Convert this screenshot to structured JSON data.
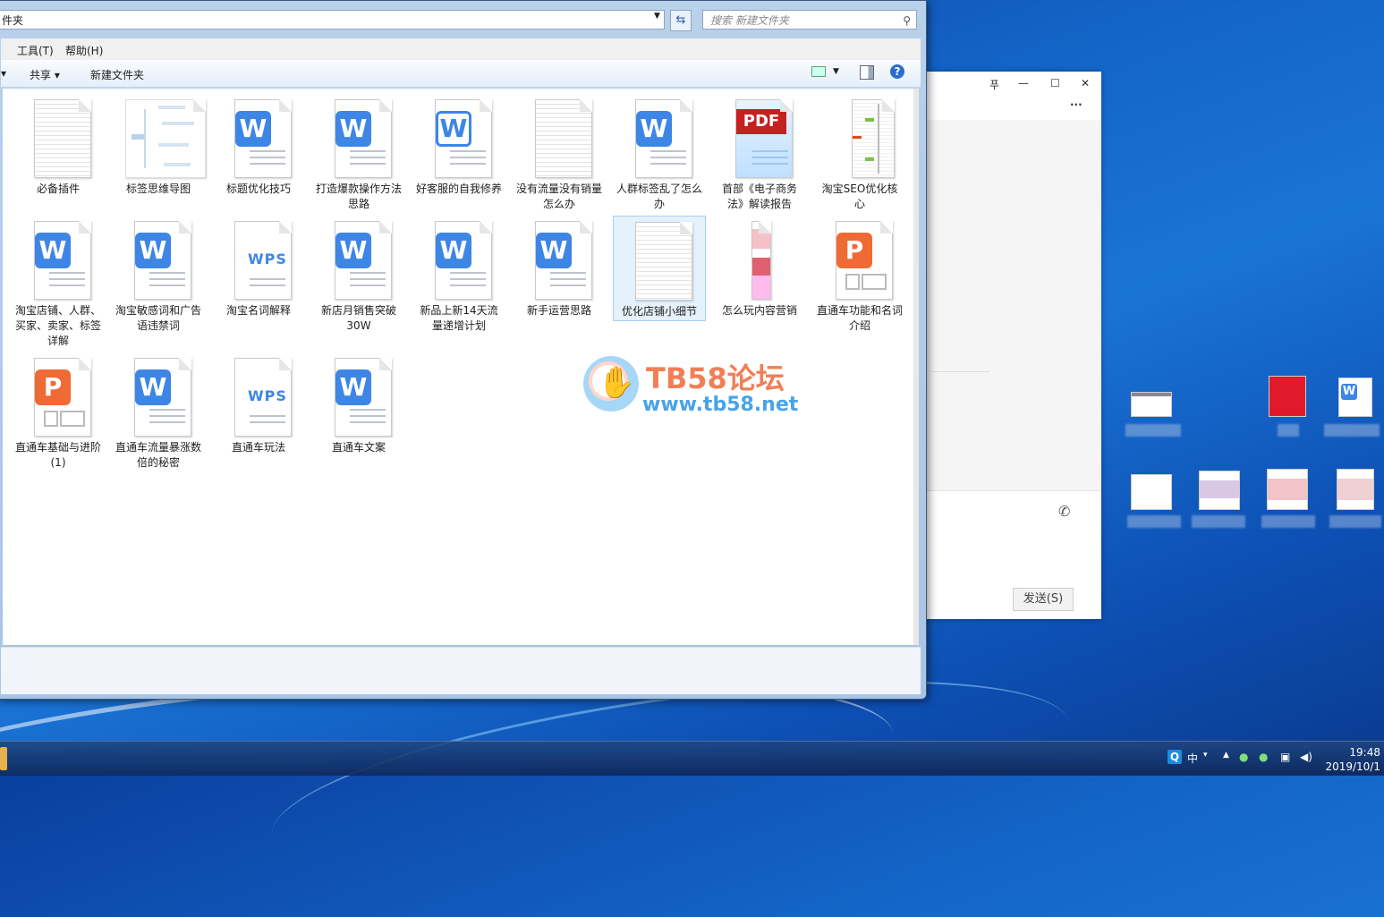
{
  "explorer": {
    "address": "件夹",
    "search_placeholder": "搜索 新建文件夹",
    "menu": {
      "tools": "工具(T)",
      "help": "帮助(H)"
    },
    "toolbar": {
      "share": "共享 ▾",
      "new_folder": "新建文件夹"
    }
  },
  "files": [
    {
      "label": "必备插件",
      "kind": "blank"
    },
    {
      "label": "标签思维导图",
      "kind": "mindmap"
    },
    {
      "label": "标题优化技巧",
      "kind": "word"
    },
    {
      "label": "打造爆款操作方法思路",
      "kind": "word"
    },
    {
      "label": "好客服的自我修养",
      "kind": "word-outline"
    },
    {
      "label": "没有流量没有销量怎么办",
      "kind": "blank"
    },
    {
      "label": "人群标签乱了怎么办",
      "kind": "word"
    },
    {
      "label": "首部《电子商务法》解读报告",
      "kind": "pdf"
    },
    {
      "label": "淘宝SEO优化核心",
      "kind": "long-image"
    },
    {
      "label": "淘宝店铺、人群、买家、卖家、标签详解",
      "kind": "word"
    },
    {
      "label": "淘宝敏感词和广告语违禁词",
      "kind": "word"
    },
    {
      "label": "淘宝名词解释",
      "kind": "wps"
    },
    {
      "label": "新店月销售突破30W",
      "kind": "word"
    },
    {
      "label": "新品上新14天流量递增计划",
      "kind": "word"
    },
    {
      "label": "新手运营思路",
      "kind": "word"
    },
    {
      "label": "优化店铺小细节",
      "kind": "blank",
      "selected": true
    },
    {
      "label": "怎么玩内容营销",
      "kind": "long-image2"
    },
    {
      "label": "直通车功能和名词介绍",
      "kind": "ppt"
    },
    {
      "label": "直通车基础与进阶(1)",
      "kind": "ppt"
    },
    {
      "label": "直通车流量暴涨数倍的秘密",
      "kind": "word"
    },
    {
      "label": "直通车玩法",
      "kind": "wps"
    },
    {
      "label": "直通车文案",
      "kind": "word"
    }
  ],
  "watermark": {
    "title": "TB58论坛",
    "url": "www.tb58.net"
  },
  "chat": {
    "send_label": "发送(S)",
    "pin": "푸",
    "min": "—",
    "max": "☐",
    "close": "✕",
    "more": "···"
  },
  "taskbar": {
    "ime": "中",
    "time": "19:48",
    "date": "2019/10/1"
  },
  "icons": {
    "W": "W",
    "P": "P",
    "WPS": "WPS",
    "PDF": "PDF"
  }
}
